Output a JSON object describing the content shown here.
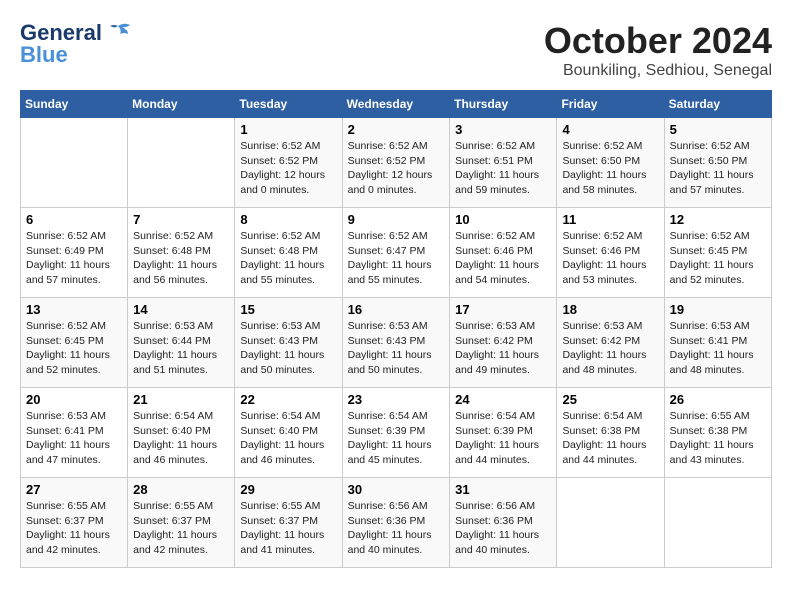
{
  "logo": {
    "line1": "General",
    "line2": "Blue"
  },
  "title": "October 2024",
  "subtitle": "Bounkiling, Sedhiou, Senegal",
  "weekdays": [
    "Sunday",
    "Monday",
    "Tuesday",
    "Wednesday",
    "Thursday",
    "Friday",
    "Saturday"
  ],
  "weeks": [
    [
      {
        "day": "",
        "info": ""
      },
      {
        "day": "",
        "info": ""
      },
      {
        "day": "1",
        "info": "Sunrise: 6:52 AM\nSunset: 6:52 PM\nDaylight: 12 hours\nand 0 minutes."
      },
      {
        "day": "2",
        "info": "Sunrise: 6:52 AM\nSunset: 6:52 PM\nDaylight: 12 hours\nand 0 minutes."
      },
      {
        "day": "3",
        "info": "Sunrise: 6:52 AM\nSunset: 6:51 PM\nDaylight: 11 hours\nand 59 minutes."
      },
      {
        "day": "4",
        "info": "Sunrise: 6:52 AM\nSunset: 6:50 PM\nDaylight: 11 hours\nand 58 minutes."
      },
      {
        "day": "5",
        "info": "Sunrise: 6:52 AM\nSunset: 6:50 PM\nDaylight: 11 hours\nand 57 minutes."
      }
    ],
    [
      {
        "day": "6",
        "info": "Sunrise: 6:52 AM\nSunset: 6:49 PM\nDaylight: 11 hours\nand 57 minutes."
      },
      {
        "day": "7",
        "info": "Sunrise: 6:52 AM\nSunset: 6:48 PM\nDaylight: 11 hours\nand 56 minutes."
      },
      {
        "day": "8",
        "info": "Sunrise: 6:52 AM\nSunset: 6:48 PM\nDaylight: 11 hours\nand 55 minutes."
      },
      {
        "day": "9",
        "info": "Sunrise: 6:52 AM\nSunset: 6:47 PM\nDaylight: 11 hours\nand 55 minutes."
      },
      {
        "day": "10",
        "info": "Sunrise: 6:52 AM\nSunset: 6:46 PM\nDaylight: 11 hours\nand 54 minutes."
      },
      {
        "day": "11",
        "info": "Sunrise: 6:52 AM\nSunset: 6:46 PM\nDaylight: 11 hours\nand 53 minutes."
      },
      {
        "day": "12",
        "info": "Sunrise: 6:52 AM\nSunset: 6:45 PM\nDaylight: 11 hours\nand 52 minutes."
      }
    ],
    [
      {
        "day": "13",
        "info": "Sunrise: 6:52 AM\nSunset: 6:45 PM\nDaylight: 11 hours\nand 52 minutes."
      },
      {
        "day": "14",
        "info": "Sunrise: 6:53 AM\nSunset: 6:44 PM\nDaylight: 11 hours\nand 51 minutes."
      },
      {
        "day": "15",
        "info": "Sunrise: 6:53 AM\nSunset: 6:43 PM\nDaylight: 11 hours\nand 50 minutes."
      },
      {
        "day": "16",
        "info": "Sunrise: 6:53 AM\nSunset: 6:43 PM\nDaylight: 11 hours\nand 50 minutes."
      },
      {
        "day": "17",
        "info": "Sunrise: 6:53 AM\nSunset: 6:42 PM\nDaylight: 11 hours\nand 49 minutes."
      },
      {
        "day": "18",
        "info": "Sunrise: 6:53 AM\nSunset: 6:42 PM\nDaylight: 11 hours\nand 48 minutes."
      },
      {
        "day": "19",
        "info": "Sunrise: 6:53 AM\nSunset: 6:41 PM\nDaylight: 11 hours\nand 48 minutes."
      }
    ],
    [
      {
        "day": "20",
        "info": "Sunrise: 6:53 AM\nSunset: 6:41 PM\nDaylight: 11 hours\nand 47 minutes."
      },
      {
        "day": "21",
        "info": "Sunrise: 6:54 AM\nSunset: 6:40 PM\nDaylight: 11 hours\nand 46 minutes."
      },
      {
        "day": "22",
        "info": "Sunrise: 6:54 AM\nSunset: 6:40 PM\nDaylight: 11 hours\nand 46 minutes."
      },
      {
        "day": "23",
        "info": "Sunrise: 6:54 AM\nSunset: 6:39 PM\nDaylight: 11 hours\nand 45 minutes."
      },
      {
        "day": "24",
        "info": "Sunrise: 6:54 AM\nSunset: 6:39 PM\nDaylight: 11 hours\nand 44 minutes."
      },
      {
        "day": "25",
        "info": "Sunrise: 6:54 AM\nSunset: 6:38 PM\nDaylight: 11 hours\nand 44 minutes."
      },
      {
        "day": "26",
        "info": "Sunrise: 6:55 AM\nSunset: 6:38 PM\nDaylight: 11 hours\nand 43 minutes."
      }
    ],
    [
      {
        "day": "27",
        "info": "Sunrise: 6:55 AM\nSunset: 6:37 PM\nDaylight: 11 hours\nand 42 minutes."
      },
      {
        "day": "28",
        "info": "Sunrise: 6:55 AM\nSunset: 6:37 PM\nDaylight: 11 hours\nand 42 minutes."
      },
      {
        "day": "29",
        "info": "Sunrise: 6:55 AM\nSunset: 6:37 PM\nDaylight: 11 hours\nand 41 minutes."
      },
      {
        "day": "30",
        "info": "Sunrise: 6:56 AM\nSunset: 6:36 PM\nDaylight: 11 hours\nand 40 minutes."
      },
      {
        "day": "31",
        "info": "Sunrise: 6:56 AM\nSunset: 6:36 PM\nDaylight: 11 hours\nand 40 minutes."
      },
      {
        "day": "",
        "info": ""
      },
      {
        "day": "",
        "info": ""
      }
    ]
  ]
}
